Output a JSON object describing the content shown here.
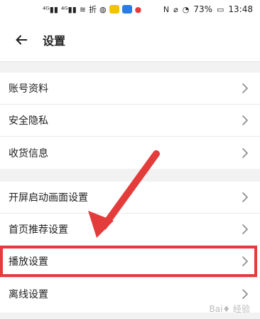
{
  "status_bar": {
    "left_icons": [
      "signal-4g-icon",
      "signal-4g-icon",
      "wifi-icon",
      "fold-icon",
      "wechat-icon",
      "notification-icon",
      "app-icon",
      "location-icon"
    ],
    "right_icons": [
      "nfc-icon",
      "silent-icon",
      "speed-icon"
    ],
    "battery": "73%",
    "time": "13:48"
  },
  "header": {
    "title": "设置"
  },
  "sections": [
    {
      "items": [
        {
          "label": "账号资料"
        },
        {
          "label": "安全隐私"
        },
        {
          "label": "收货信息"
        }
      ]
    },
    {
      "items": [
        {
          "label": "开屏启动画面设置"
        },
        {
          "label": "首页推荐设置"
        },
        {
          "label": "播放设置"
        },
        {
          "label": "离线设置"
        }
      ]
    }
  ],
  "colors": {
    "highlight": "#e43b3b",
    "background": "#f2f2f2",
    "card": "#ffffff"
  }
}
